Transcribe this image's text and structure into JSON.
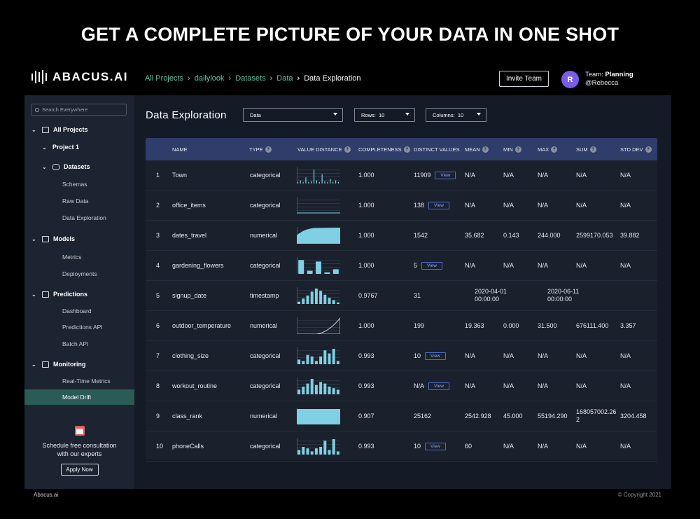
{
  "headline": "GET A COMPLETE PICTURE OF YOUR DATA IN ONE SHOT",
  "brand": "ABACUS.AI",
  "breadcrumbs": [
    "All Projects",
    "dailylook",
    "Datasets",
    "Data"
  ],
  "breadcrumb_current": "Data Exploration",
  "invite_label": "Invite Team",
  "avatar_initial": "R",
  "team": {
    "label": "Team:",
    "name": "Planning",
    "user": "@Rebecca"
  },
  "search_placeholder": "Search Everywhere",
  "nav": {
    "all_projects": "All Projects",
    "project": "Project 1",
    "datasets": "Datasets",
    "schemas": "Schemas",
    "raw_data": "Raw Data",
    "data_exploration": "Data Exploration",
    "models": "Models",
    "metrics": "Metrics",
    "deployments": "Deployments",
    "predictions": "Predictions",
    "dashboard": "Dashboard",
    "predictions_api": "Predictions API",
    "batch_api": "Batch API",
    "monitoring": "Monitoring",
    "real_time_metrics": "Real-Time Metrics",
    "model_drift": "Model Drift"
  },
  "promo": {
    "line1": "Schedule free consultation",
    "line2": "with our experts",
    "button": "Apply Now"
  },
  "footer": {
    "left": "Abacus.ai",
    "right": "© Copyright 2021"
  },
  "page_title": "Data Exploration",
  "controls": {
    "dataset_select": "Data",
    "rows_label": "Rows:",
    "rows_value": "10",
    "columns_label": "Columns:",
    "columns_value": "10"
  },
  "columns": [
    "NAME",
    "TYPE",
    "VALUE DISTANCE",
    "COMPLETENESS",
    "DISTINCT VALUES",
    "MEAN",
    "MIN",
    "MAX",
    "SUM",
    "STD DEV"
  ],
  "view_label": "View",
  "rows": [
    {
      "idx": "1",
      "name": "Town",
      "type": "categorical",
      "completeness": "1.000",
      "distinct": "11909",
      "view": true,
      "mean": "N/A",
      "min": "N/A",
      "max": "N/A",
      "sum": "N/A",
      "std": "N/A",
      "dist": "spiky"
    },
    {
      "idx": "2",
      "name": "office_items",
      "type": "categorical",
      "completeness": "1.000",
      "distinct": "138",
      "view": true,
      "mean": "N/A",
      "min": "N/A",
      "max": "N/A",
      "sum": "N/A",
      "std": "N/A",
      "dist": "flat"
    },
    {
      "idx": "3",
      "name": "dates_travel",
      "type": "numerical",
      "completeness": "1.000",
      "distinct": "1542",
      "view": false,
      "mean": "35.682",
      "min": "0.143",
      "max": "244.000",
      "sum": "2599170.053",
      "std": "39.882",
      "dist": "log"
    },
    {
      "idx": "4",
      "name": "gardening_flowers",
      "type": "categorical",
      "completeness": "1.000",
      "distinct": "5",
      "view": true,
      "mean": "N/A",
      "min": "N/A",
      "max": "N/A",
      "sum": "N/A",
      "std": "N/A",
      "dist": "bars5"
    },
    {
      "idx": "5",
      "name": "signup_date",
      "type": "timestamp",
      "completeness": "0.9767",
      "distinct": "31",
      "view": false,
      "mean": "",
      "min": "2020-04-01 00:00:00",
      "max": "2020-06-11 00:00:00",
      "sum": "",
      "std": "",
      "dist": "bell"
    },
    {
      "idx": "6",
      "name": "outdoor_temperature",
      "type": "numerical",
      "completeness": "1.000",
      "distinct": "199",
      "view": false,
      "mean": "19.363",
      "min": "0.000",
      "max": "31.500",
      "sum": "676111.400",
      "std": "3.357",
      "dist": "exp"
    },
    {
      "idx": "7",
      "name": "clothing_size",
      "type": "categorical",
      "completeness": "0.993",
      "distinct": "10",
      "view": true,
      "mean": "N/A",
      "min": "N/A",
      "max": "N/A",
      "sum": "N/A",
      "std": "N/A",
      "dist": "bars10a"
    },
    {
      "idx": "8",
      "name": "workout_routine",
      "type": "categorical",
      "completeness": "0.993",
      "distinct": "N/A",
      "view": true,
      "mean": "N/A",
      "min": "N/A",
      "max": "N/A",
      "sum": "N/A",
      "std": "N/A",
      "dist": "bars10b"
    },
    {
      "idx": "9",
      "name": "class_rank",
      "type": "numerical",
      "completeness": "0.907",
      "distinct": "25162",
      "view": false,
      "mean": "2542.928",
      "min": "45.000",
      "max": "55194.290",
      "sum": "168057002.262",
      "std": "3204.458",
      "dist": "block"
    },
    {
      "idx": "10",
      "name": "phoneCalls",
      "type": "categorical",
      "completeness": "0.993",
      "distinct": "10",
      "view": true,
      "mean": "60",
      "min": "N/A",
      "max": "N/A",
      "sum": "N/A",
      "std": "N/A",
      "dist": "bars10c"
    }
  ]
}
